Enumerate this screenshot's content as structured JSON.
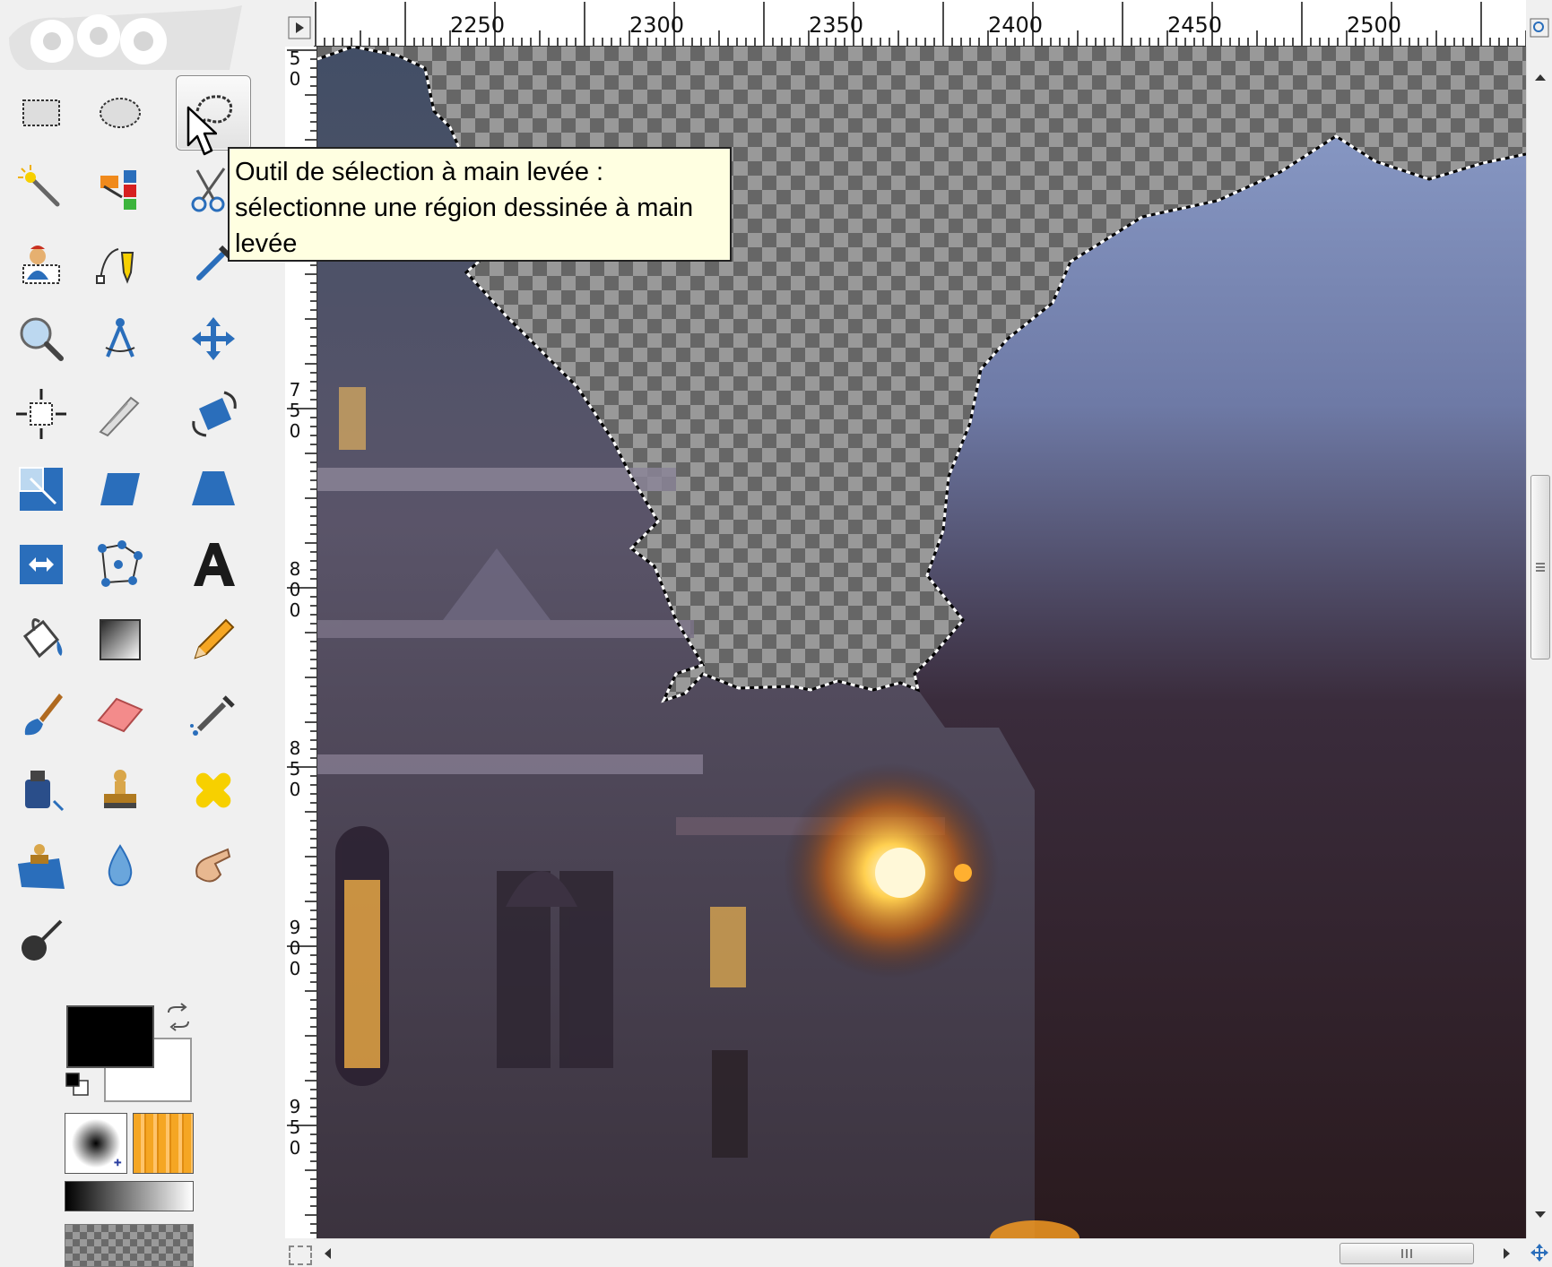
{
  "tooltip": {
    "line1": "Outil de sélection à main levée :",
    "line2": "sélectionne une région dessinée à main",
    "line3": "levée"
  },
  "ruler": {
    "horizontal": [
      "2250",
      "2300",
      "2350",
      "2400",
      "2450",
      "2500"
    ],
    "vertical": [
      [
        "5",
        "0"
      ],
      [
        "7",
        "5",
        "0"
      ],
      [
        "8",
        "0",
        "0"
      ],
      [
        "8",
        "5",
        "0"
      ],
      [
        "9",
        "0",
        "0"
      ],
      [
        "9",
        "5",
        "0"
      ]
    ]
  },
  "toolbox": {
    "selected_tool": "free-select",
    "tools": [
      {
        "name": "rect-select-tool",
        "icon": "rect-select-icon"
      },
      {
        "name": "ellipse-select-tool",
        "icon": "ellipse-select-icon"
      },
      {
        "name": "free-select-tool",
        "icon": "lasso-icon"
      },
      {
        "name": "fuzzy-select-tool",
        "icon": "magic-wand-icon"
      },
      {
        "name": "select-by-color-tool",
        "icon": "color-select-icon"
      },
      {
        "name": "scissors-select-tool",
        "icon": "scissors-icon"
      },
      {
        "name": "foreground-select-tool",
        "icon": "foreground-select-icon"
      },
      {
        "name": "paths-tool",
        "icon": "paths-pen-icon"
      },
      {
        "name": "color-picker-tool",
        "icon": "eyedropper-icon"
      },
      {
        "name": "zoom-tool",
        "icon": "magnifier-icon"
      },
      {
        "name": "measure-tool",
        "icon": "compass-icon"
      },
      {
        "name": "move-tool",
        "icon": "move-arrows-icon"
      },
      {
        "name": "align-tool",
        "icon": "align-icon"
      },
      {
        "name": "crop-tool",
        "icon": "crop-knife-icon"
      },
      {
        "name": "rotate-tool",
        "icon": "rotate-icon"
      },
      {
        "name": "scale-tool",
        "icon": "scale-icon"
      },
      {
        "name": "shear-tool",
        "icon": "shear-icon"
      },
      {
        "name": "perspective-tool",
        "icon": "perspective-icon"
      },
      {
        "name": "flip-tool",
        "icon": "flip-icon"
      },
      {
        "name": "cage-tool",
        "icon": "cage-icon"
      },
      {
        "name": "text-tool",
        "icon": "text-a-icon"
      },
      {
        "name": "bucket-fill-tool",
        "icon": "paint-bucket-icon"
      },
      {
        "name": "blend-tool",
        "icon": "gradient-icon"
      },
      {
        "name": "pencil-tool",
        "icon": "pencil-icon"
      },
      {
        "name": "paintbrush-tool",
        "icon": "paintbrush-icon"
      },
      {
        "name": "eraser-tool",
        "icon": "eraser-icon"
      },
      {
        "name": "airbrush-tool",
        "icon": "airbrush-icon"
      },
      {
        "name": "ink-tool",
        "icon": "ink-bottle-icon"
      },
      {
        "name": "clone-tool",
        "icon": "clone-stamp-icon"
      },
      {
        "name": "heal-tool",
        "icon": "bandage-icon"
      },
      {
        "name": "perspective-clone-tool",
        "icon": "perspective-clone-icon"
      },
      {
        "name": "blur-sharpen-tool",
        "icon": "water-drop-icon"
      },
      {
        "name": "smudge-tool",
        "icon": "smudge-finger-icon"
      },
      {
        "name": "dodge-burn-tool",
        "icon": "dodge-burn-icon"
      }
    ],
    "foreground_color": "#000000",
    "background_color": "#ffffff"
  },
  "colors": {
    "tooltip_bg": "#ffffe1",
    "checker_dark": "#666666",
    "checker_light": "#999999",
    "accent_blue": "#2a6ebb"
  }
}
